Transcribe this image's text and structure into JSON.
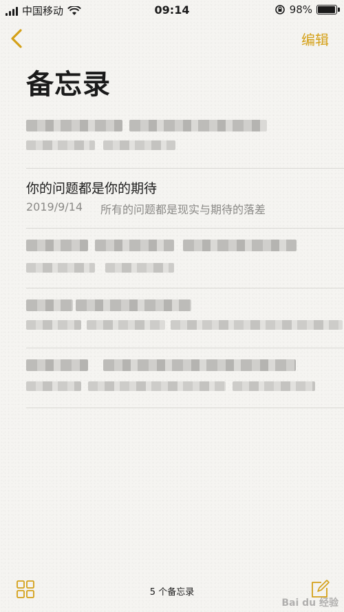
{
  "status_bar": {
    "carrier": "中国移动",
    "time": "09:14",
    "battery": "98%",
    "battery_level": 0.98
  },
  "nav": {
    "edit_label": "编辑"
  },
  "page_title": "备忘录",
  "notes": {
    "visible_note": {
      "title": "你的问题都是你的期待",
      "date": "2019/9/14",
      "preview": "所有的问题都是现实与期待的落差"
    }
  },
  "footer": {
    "count_label": "5 个备忘录"
  },
  "watermark": "Bai du 经验",
  "colors": {
    "accent": "#d4a017",
    "background": "#f5f4f1",
    "separator": "#d9d8d4",
    "secondary_text": "#8a8986"
  }
}
